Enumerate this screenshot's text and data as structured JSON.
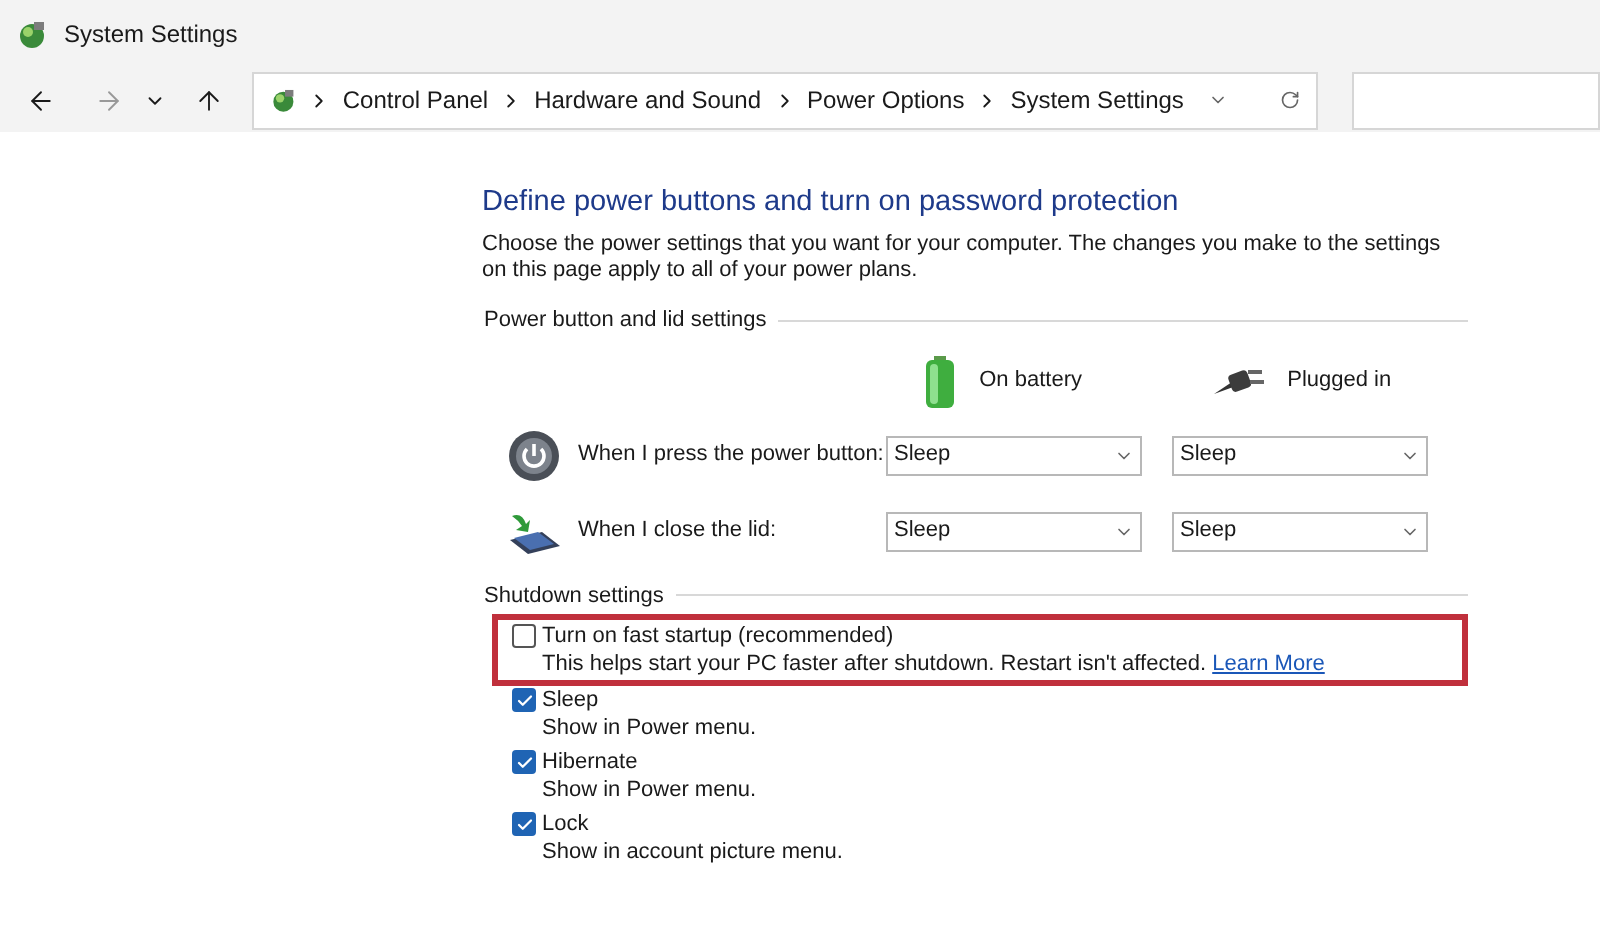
{
  "window": {
    "title": "System Settings"
  },
  "breadcrumb": [
    "Control Panel",
    "Hardware and Sound",
    "Power Options",
    "System Settings"
  ],
  "heading": "Define power buttons and turn on password protection",
  "description": "Choose the power settings that you want for your computer. The changes you make to the settings on this page apply to all of your power plans.",
  "power_section": {
    "title": "Power button and lid settings",
    "columns": [
      {
        "kind": "battery",
        "label": "On battery"
      },
      {
        "kind": "plug",
        "label": "Plugged in"
      }
    ],
    "rows": [
      {
        "kind": "power",
        "label": "When I press the power button:",
        "values": [
          "Sleep",
          "Sleep"
        ]
      },
      {
        "kind": "lid",
        "label": "When I close the lid:",
        "values": [
          "Sleep",
          "Sleep"
        ]
      }
    ]
  },
  "shutdown_section": {
    "title": "Shutdown settings",
    "options": [
      {
        "label": "Turn on fast startup (recommended)",
        "description": "This helps start your PC faster after shutdown. Restart isn't affected.",
        "link": "Learn More",
        "checked": false,
        "highlighted": true
      },
      {
        "label": "Sleep",
        "description": "Show in Power menu.",
        "checked": true,
        "highlighted": false
      },
      {
        "label": "Hibernate",
        "description": "Show in Power menu.",
        "checked": true,
        "highlighted": false
      },
      {
        "label": "Lock",
        "description": "Show in account picture menu.",
        "checked": true,
        "highlighted": false
      }
    ]
  }
}
